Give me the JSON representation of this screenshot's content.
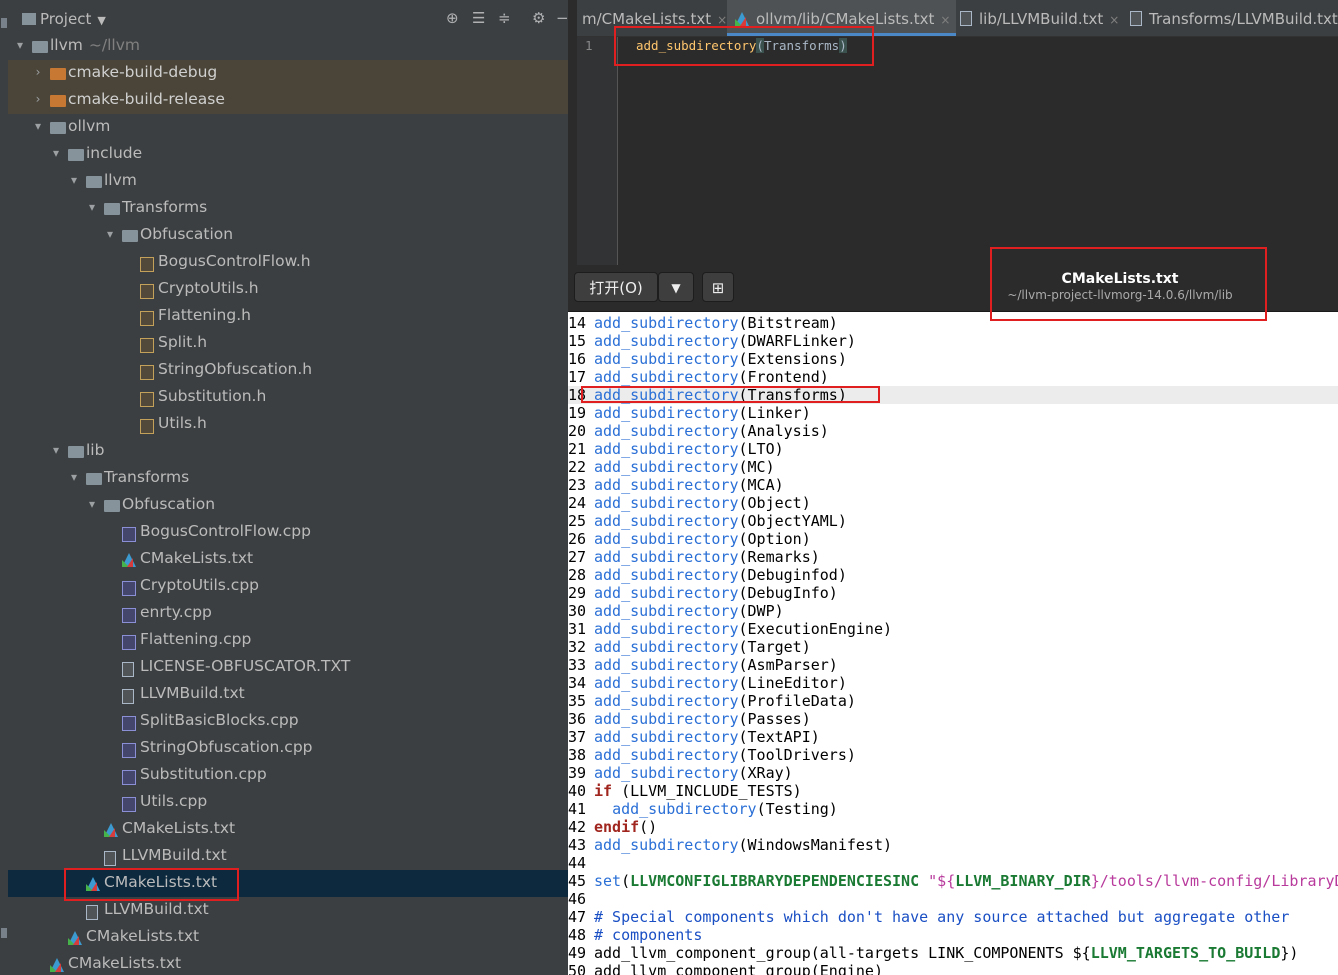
{
  "project_panel": {
    "title": "Project",
    "tool_icons": [
      "locate-icon",
      "expand-all-icon",
      "collapse-all-icon",
      "settings-icon",
      "hide-icon"
    ],
    "tree": [
      {
        "label": "llvm",
        "suffix": "~/llvm",
        "icon": "module-folder",
        "depth": 0,
        "arrow": "▾"
      },
      {
        "label": "cmake-build-debug",
        "icon": "folder-orange",
        "depth": 1,
        "arrow": "›",
        "state": "excluded"
      },
      {
        "label": "cmake-build-release",
        "icon": "folder-orange",
        "depth": 1,
        "arrow": "›",
        "state": "excluded"
      },
      {
        "label": "ollvm",
        "icon": "folder",
        "depth": 1,
        "arrow": "▾"
      },
      {
        "label": "include",
        "icon": "folder",
        "depth": 2,
        "arrow": "▾"
      },
      {
        "label": "llvm",
        "icon": "folder",
        "depth": 3,
        "arrow": "▾"
      },
      {
        "label": "Transforms",
        "icon": "folder",
        "depth": 4,
        "arrow": "▾"
      },
      {
        "label": "Obfuscation",
        "icon": "folder",
        "depth": 5,
        "arrow": "▾"
      },
      {
        "label": "BogusControlFlow.h",
        "icon": "header",
        "depth": 6
      },
      {
        "label": "CryptoUtils.h",
        "icon": "header",
        "depth": 6
      },
      {
        "label": "Flattening.h",
        "icon": "header",
        "depth": 6
      },
      {
        "label": "Split.h",
        "icon": "header",
        "depth": 6
      },
      {
        "label": "StringObfuscation.h",
        "icon": "header",
        "depth": 6
      },
      {
        "label": "Substitution.h",
        "icon": "header",
        "depth": 6
      },
      {
        "label": "Utils.h",
        "icon": "header",
        "depth": 6
      },
      {
        "label": "lib",
        "icon": "folder",
        "depth": 2,
        "arrow": "▾"
      },
      {
        "label": "Transforms",
        "icon": "folder",
        "depth": 3,
        "arrow": "▾"
      },
      {
        "label": "Obfuscation",
        "icon": "folder",
        "depth": 4,
        "arrow": "▾"
      },
      {
        "label": "BogusControlFlow.cpp",
        "icon": "cpp",
        "depth": 5
      },
      {
        "label": "CMakeLists.txt",
        "icon": "cmake",
        "depth": 5
      },
      {
        "label": "CryptoUtils.cpp",
        "icon": "cpp",
        "depth": 5
      },
      {
        "label": "enrty.cpp",
        "icon": "cpp",
        "depth": 5
      },
      {
        "label": "Flattening.cpp",
        "icon": "cpp",
        "depth": 5
      },
      {
        "label": "LICENSE-OBFUSCATOR.TXT",
        "icon": "text",
        "depth": 5
      },
      {
        "label": "LLVMBuild.txt",
        "icon": "text",
        "depth": 5
      },
      {
        "label": "SplitBasicBlocks.cpp",
        "icon": "cpp",
        "depth": 5
      },
      {
        "label": "StringObfuscation.cpp",
        "icon": "cpp",
        "depth": 5
      },
      {
        "label": "Substitution.cpp",
        "icon": "cpp",
        "depth": 5
      },
      {
        "label": "Utils.cpp",
        "icon": "cpp",
        "depth": 5
      },
      {
        "label": "CMakeLists.txt",
        "icon": "cmake",
        "depth": 4
      },
      {
        "label": "LLVMBuild.txt",
        "icon": "text",
        "depth": 4
      },
      {
        "label": "CMakeLists.txt",
        "icon": "cmake",
        "depth": 3,
        "state": "selected"
      },
      {
        "label": "LLVMBuild.txt",
        "icon": "text",
        "depth": 3
      },
      {
        "label": "CMakeLists.txt",
        "icon": "cmake",
        "depth": 2
      },
      {
        "label": "CMakeLists.txt",
        "icon": "cmake",
        "depth": 1
      }
    ]
  },
  "editor": {
    "tabs": [
      {
        "label": "m/CMakeLists.txt",
        "icon": "cmake"
      },
      {
        "label": "ollvm/lib/CMakeLists.txt",
        "icon": "cmake",
        "active": true
      },
      {
        "label": "lib/LLVMBuild.txt",
        "icon": "text"
      },
      {
        "label": "Transforms/LLVMBuild.txt",
        "icon": "text"
      }
    ],
    "line_number": "1",
    "code_fn": "add_subdirectory",
    "code_open": "(",
    "code_arg": "Transforms",
    "code_close": ")"
  },
  "viewer": {
    "open_button": "打开(O)",
    "dropdown_icon": "triangle-down-icon",
    "new_window_icon": "pin-icon",
    "title": "CMakeLists.txt",
    "path": "~/llvm-project-llvmorg-14.0.6/llvm/lib",
    "lines": [
      {
        "n": "14",
        "fn": "add_subdirectory",
        "rest": "(Bitstream)"
      },
      {
        "n": "15",
        "fn": "add_subdirectory",
        "rest": "(DWARFLinker)"
      },
      {
        "n": "16",
        "fn": "add_subdirectory",
        "rest": "(Extensions)"
      },
      {
        "n": "17",
        "fn": "add_subdirectory",
        "rest": "(Frontend)"
      },
      {
        "n": "18",
        "fn": "add_subdirectory",
        "rest": "(Transforms)",
        "highlight": true
      },
      {
        "n": "19",
        "fn": "add_subdirectory",
        "rest": "(Linker)"
      },
      {
        "n": "20",
        "fn": "add_subdirectory",
        "rest": "(Analysis)"
      },
      {
        "n": "21",
        "fn": "add_subdirectory",
        "rest": "(LTO)"
      },
      {
        "n": "22",
        "fn": "add_subdirectory",
        "rest": "(MC)"
      },
      {
        "n": "23",
        "fn": "add_subdirectory",
        "rest": "(MCA)"
      },
      {
        "n": "24",
        "fn": "add_subdirectory",
        "rest": "(Object)"
      },
      {
        "n": "25",
        "fn": "add_subdirectory",
        "rest": "(ObjectYAML)"
      },
      {
        "n": "26",
        "fn": "add_subdirectory",
        "rest": "(Option)"
      },
      {
        "n": "27",
        "fn": "add_subdirectory",
        "rest": "(Remarks)"
      },
      {
        "n": "28",
        "fn": "add_subdirectory",
        "rest": "(Debuginfod)"
      },
      {
        "n": "29",
        "fn": "add_subdirectory",
        "rest": "(DebugInfo)"
      },
      {
        "n": "30",
        "fn": "add_subdirectory",
        "rest": "(DWP)"
      },
      {
        "n": "31",
        "fn": "add_subdirectory",
        "rest": "(ExecutionEngine)"
      },
      {
        "n": "32",
        "fn": "add_subdirectory",
        "rest": "(Target)"
      },
      {
        "n": "33",
        "fn": "add_subdirectory",
        "rest": "(AsmParser)"
      },
      {
        "n": "34",
        "fn": "add_subdirectory",
        "rest": "(LineEditor)"
      },
      {
        "n": "35",
        "fn": "add_subdirectory",
        "rest": "(ProfileData)"
      },
      {
        "n": "36",
        "fn": "add_subdirectory",
        "rest": "(Passes)"
      },
      {
        "n": "37",
        "fn": "add_subdirectory",
        "rest": "(TextAPI)"
      },
      {
        "n": "38",
        "fn": "add_subdirectory",
        "rest": "(ToolDrivers)"
      },
      {
        "n": "39",
        "fn": "add_subdirectory",
        "rest": "(XRay)"
      },
      {
        "n": "40",
        "kw": "if",
        "rest": " (LLVM_INCLUDE_TESTS)"
      },
      {
        "n": "41",
        "indent": "  ",
        "fn": "add_subdirectory",
        "rest": "(Testing)"
      },
      {
        "n": "42",
        "kw": "endif",
        "rest": "()"
      },
      {
        "n": "43",
        "fn": "add_subdirectory",
        "rest": "(WindowsManifest)"
      },
      {
        "n": "44"
      },
      {
        "n": "45",
        "set": "set",
        "rest": "(",
        "var": "LLVMCONFIGLIBRARYDEPENDENCIESINC",
        "str1": " \"${",
        "var2": "LLVM_BINARY_DIR",
        "str2": "}/tools/llvm-config/LibraryD"
      },
      {
        "n": "46"
      },
      {
        "n": "47",
        "comment": "# Special components which don't have any source attached but aggregate other"
      },
      {
        "n": "48",
        "comment": "# components"
      },
      {
        "n": "49",
        "plain": "add_llvm_component_group(all-targets LINK_COMPONENTS ${",
        "var": "LLVM_TARGETS_TO_BUILD",
        "tail": "})"
      },
      {
        "n": "50",
        "plain": "add_llvm_component_group(Engine)"
      }
    ]
  },
  "colors": {
    "annotation": "#e02020",
    "selection": "#0d293e",
    "excluded": "#4a4538"
  }
}
